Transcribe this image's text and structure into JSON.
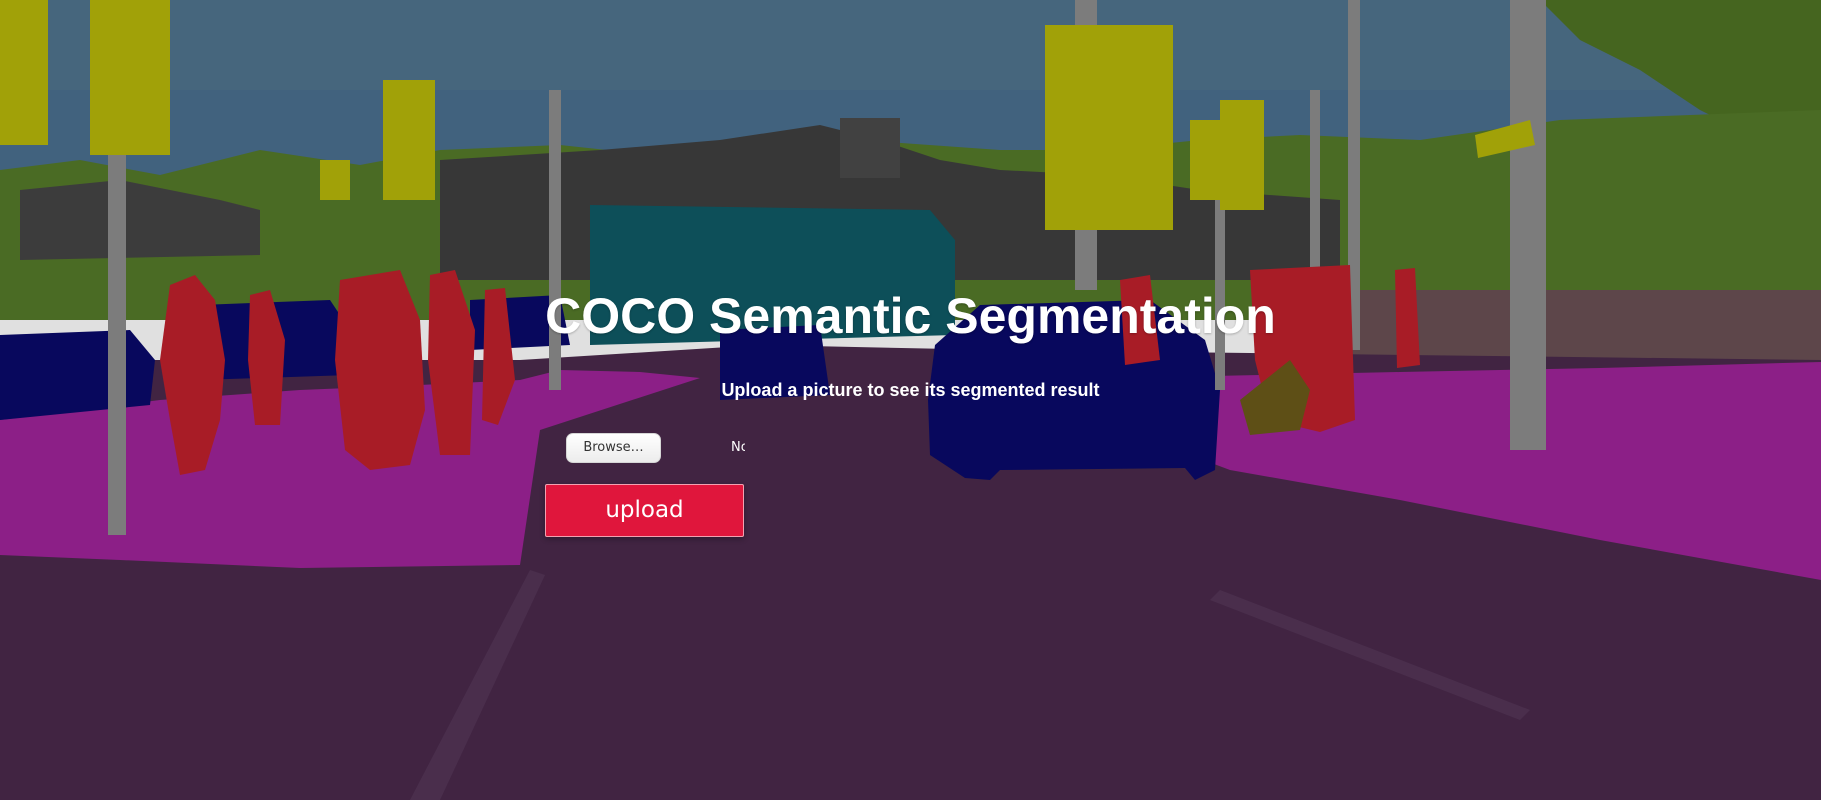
{
  "page": {
    "title": "COCO Semantic Segmentation",
    "subtitle": "Upload a picture to see its segmented result"
  },
  "upload_form": {
    "browse_label": "Browse…",
    "file_status": "No file selected.",
    "upload_label": "upload"
  },
  "colors": {
    "road": "#4a2a4c",
    "sidewalk": "#a0249a",
    "sky": "#4a7090",
    "vegetation": "#557a2a",
    "building": "#454545",
    "person": "#c0202c",
    "car": "#0a0a6a",
    "bus": "#0f5a66",
    "traffic_sign": "#b8b80a",
    "pole": "#8e8e8e",
    "upload_button": "#e0163c"
  }
}
